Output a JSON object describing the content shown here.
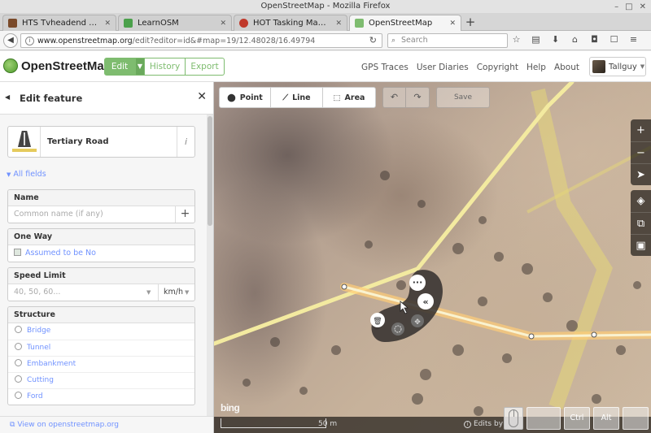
{
  "window": {
    "title": "OpenStreetMap - Mozilla Firefox",
    "buttons": [
      "–",
      "□",
      "✕"
    ]
  },
  "browser": {
    "tabs": [
      {
        "label": "HTS Tvheadend 4.0.8 ~ O...",
        "favicon_color": "#7a4a2a",
        "active": false
      },
      {
        "label": "LearnOSM",
        "favicon_color": "#4aa04a",
        "active": false
      },
      {
        "label": "HOT Tasking Manager - ...",
        "favicon_color": "#c0392b",
        "active": false
      },
      {
        "label": "OpenStreetMap",
        "favicon_color": "#7ebc6f",
        "active": true
      }
    ],
    "new_tab": "+",
    "url_host": "www.openstreetmap.org",
    "url_path": "/edit?editor=id&#map=19/12.48028/16.49794",
    "search_placeholder": "Search",
    "toolbar_icons": [
      "star-icon",
      "reading-list-icon",
      "download-icon",
      "home-icon",
      "pocket-icon",
      "chat-icon",
      "menu-icon"
    ]
  },
  "idheader": {
    "title": "OpenStreetMap",
    "modes": {
      "edit": "Edit",
      "history": "History",
      "export": "Export"
    },
    "links": [
      "GPS Traces",
      "User Diaries",
      "Copyright",
      "Help",
      "About"
    ],
    "user": "Tallguy"
  },
  "sidebar": {
    "title": "Edit feature",
    "preset_name": "Tertiary Road",
    "preset_info": "i",
    "all_fields": "All fields",
    "fields": {
      "name": {
        "label": "Name",
        "placeholder": "Common name (if any)"
      },
      "oneway": {
        "label": "One Way",
        "value": "Assumed to be No"
      },
      "speed": {
        "label": "Speed Limit",
        "placeholder": "40, 50, 60...",
        "unit": "km/h"
      },
      "structure": {
        "label": "Structure",
        "options": [
          "Bridge",
          "Tunnel",
          "Embankment",
          "Cutting",
          "Ford"
        ]
      }
    },
    "footer_link": "View on openstreetmap.org"
  },
  "map": {
    "tools": {
      "point": "Point",
      "line": "Line",
      "area": "Area"
    },
    "save": "Save",
    "attribution": "bing",
    "scale_label": "50 m",
    "edits_by": "Edits by"
  },
  "keys": {
    "ctrl": "Ctrl",
    "alt": "Alt"
  }
}
